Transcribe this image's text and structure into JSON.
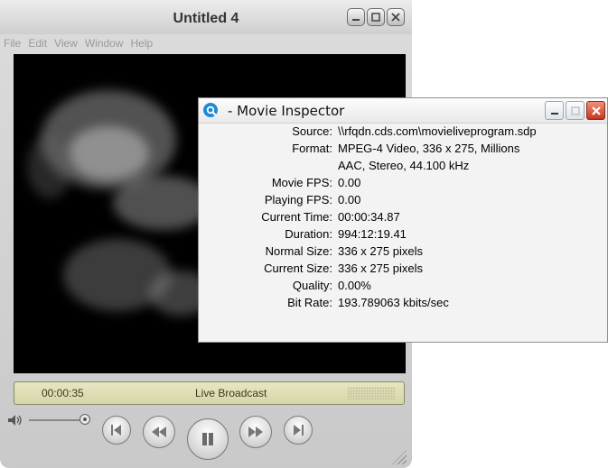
{
  "player": {
    "title": "Untitled 4",
    "menu": [
      "File",
      "Edit",
      "View",
      "Window",
      "Help"
    ],
    "lcd": {
      "time": "00:00:35",
      "status": "Live Broadcast"
    },
    "volume_level": 1.0
  },
  "inspector": {
    "title": "- Movie Inspector",
    "rows": [
      {
        "label": "Source:",
        "value": "\\\\rfqdn.cds.com\\movieliveprogram.sdp"
      },
      {
        "label": "Format:",
        "value": "MPEG-4 Video, 336 x 275, Millions"
      },
      {
        "label": "",
        "value": "AAC, Stereo, 44.100 kHz"
      },
      {
        "label": "Movie FPS:",
        "value": "0.00"
      },
      {
        "label": "Playing FPS:",
        "value": "0.00"
      },
      {
        "label": "Current Time:",
        "value": "00:00:34.87"
      },
      {
        "label": "Duration:",
        "value": "994:12:19.41"
      },
      {
        "label": "Normal Size:",
        "value": "336 x 275 pixels"
      },
      {
        "label": "Current Size:",
        "value": "336 x 275 pixels"
      },
      {
        "label": "Quality:",
        "value": "0.00%"
      },
      {
        "label": "Bit Rate:",
        "value": "193.789063 kbits/sec"
      }
    ]
  },
  "colors": {
    "close": "#c5371e",
    "lcd": "#e2e1b9",
    "logo": "#1e8ad6"
  }
}
